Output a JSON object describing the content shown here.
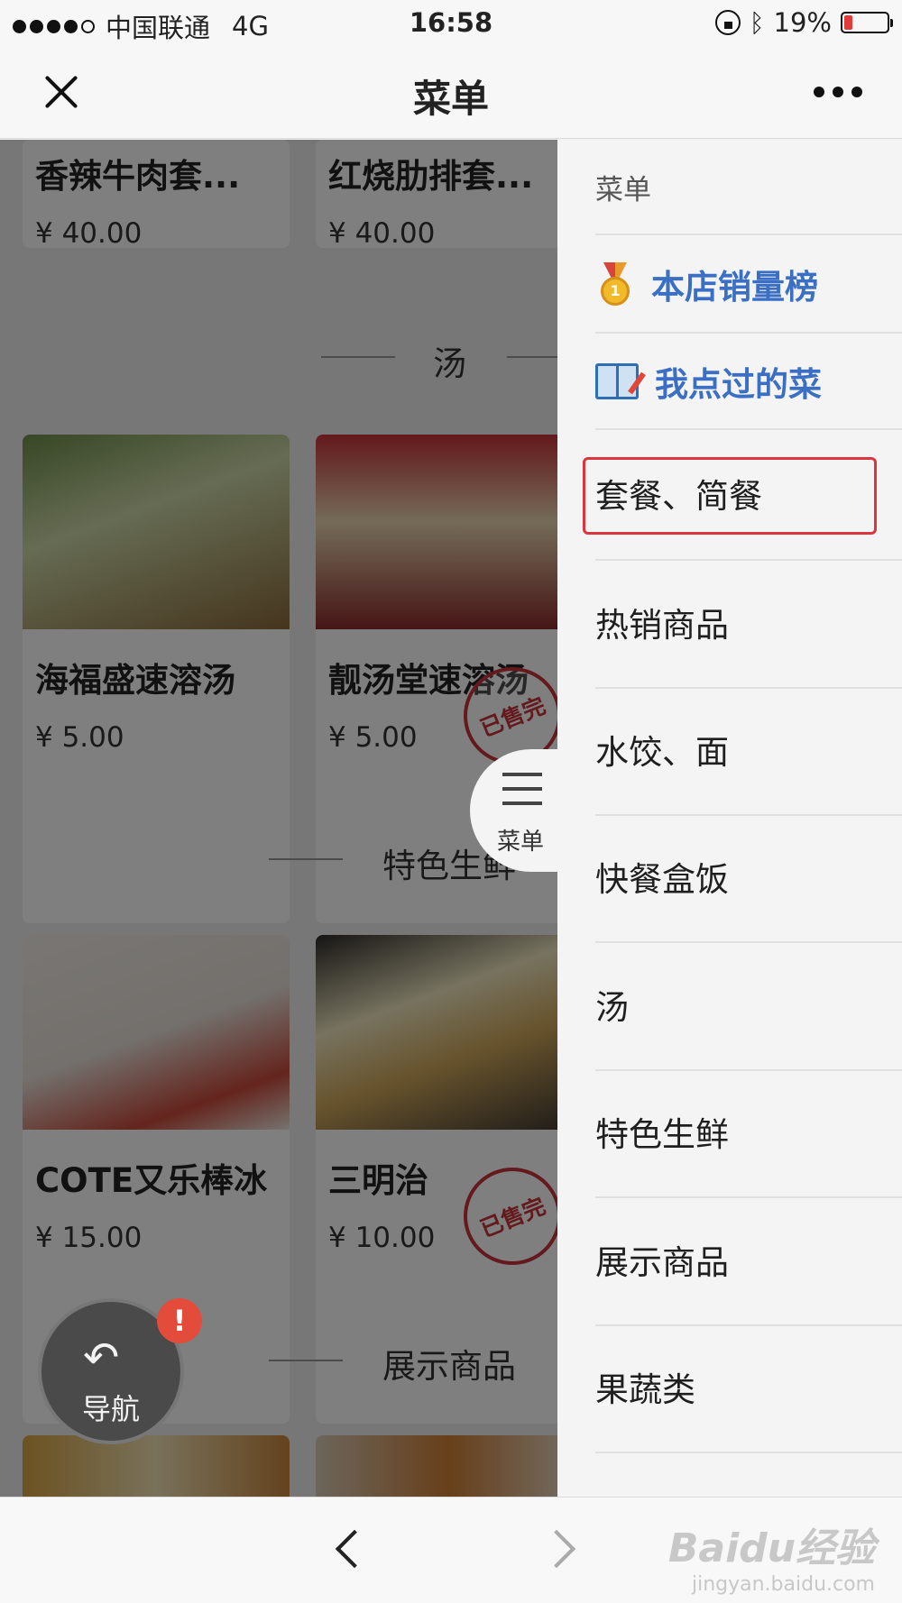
{
  "status_bar": {
    "carrier": "中国联通",
    "network": "4G",
    "time": "16:58",
    "battery": "19%",
    "bluetooth_icon": "ᛒ"
  },
  "nav": {
    "title": "菜单",
    "close_icon": "close-icon",
    "more_icon": "more-icon"
  },
  "products": {
    "row1": [
      {
        "name": "香辣牛肉套...",
        "price": "¥ 40.00"
      },
      {
        "name": "红烧肋排套...",
        "price": "¥ 40.00"
      }
    ],
    "section_soup": "汤",
    "row2": [
      {
        "name": "海福盛速溶汤",
        "price": "¥ 5.00"
      },
      {
        "name": "靓汤堂速溶汤",
        "price": "¥ 5.00",
        "stamp": "已售完"
      }
    ],
    "section_fresh": "特色生鲜",
    "row3": [
      {
        "name": "COTE又乐棒冰",
        "price": "¥ 15.00"
      },
      {
        "name": "三明治",
        "price": "¥ 10.00",
        "stamp": "已售完"
      }
    ],
    "section_display": "展示商品"
  },
  "float_nav": {
    "label": "导航",
    "badge": "!",
    "arrow_icon": "↶"
  },
  "drawer": {
    "header": "菜单",
    "special_items": [
      {
        "label": "本店销量榜",
        "icon": "medal-icon",
        "medal_number": "1"
      },
      {
        "label": "我点过的菜",
        "icon": "book-icon"
      }
    ],
    "categories": [
      {
        "label": "套餐、简餐",
        "selected": true
      },
      {
        "label": "热销商品"
      },
      {
        "label": "水饺、面"
      },
      {
        "label": "快餐盒饭"
      },
      {
        "label": "汤"
      },
      {
        "label": "特色生鲜"
      },
      {
        "label": "展示商品"
      },
      {
        "label": "果蔬类"
      }
    ],
    "accent_color": "#3b6fc4",
    "selected_border_color": "#d9363e"
  },
  "menu_tab": {
    "label": "菜单",
    "icon": "list-icon"
  },
  "bottom_bar": {
    "back_icon": "back-arrow-icon",
    "forward_icon": "forward-arrow-icon",
    "watermark_main": "Baidu经验",
    "watermark_sub": "jingyan.baidu.com"
  }
}
